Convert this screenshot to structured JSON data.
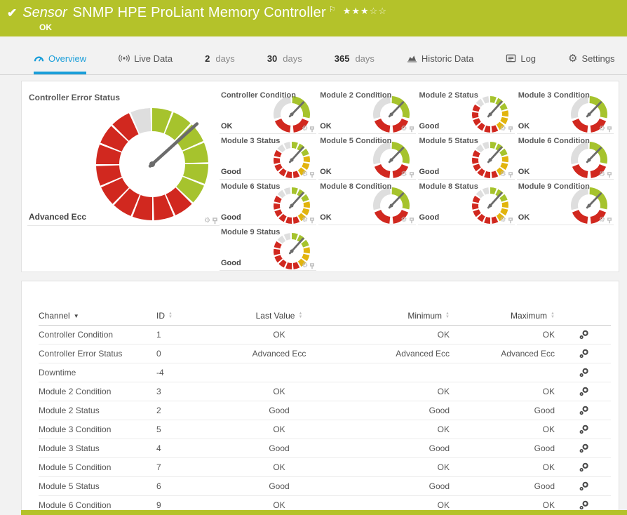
{
  "header": {
    "check_icon": "✔",
    "kind": "Sensor",
    "title": "SNMP HPE ProLiant Memory Controller",
    "priority_stars_filled": "★★★",
    "priority_stars_empty": "☆☆",
    "status": "OK"
  },
  "tabs": {
    "overview": "Overview",
    "live_data": "Live Data",
    "days2_num": "2",
    "days2_unit": "days",
    "days30_num": "30",
    "days30_unit": "days",
    "days365_num": "365",
    "days365_unit": "days",
    "historic": "Historic Data",
    "log": "Log",
    "settings": "Settings",
    "settings_gear": "⚙"
  },
  "gauge_panel": {
    "main": {
      "title": "Controller Error Status",
      "value": "Advanced Ecc",
      "style": "big",
      "needle_deg": 48
    },
    "tiles": [
      {
        "title": "Controller Condition",
        "value": "OK",
        "style": "condition",
        "needle_deg": 44
      },
      {
        "title": "Module 2 Condition",
        "value": "OK",
        "style": "condition",
        "needle_deg": 44
      },
      {
        "title": "Module 2 Status",
        "value": "Good",
        "style": "status",
        "needle_deg": 42
      },
      {
        "title": "Module 3 Condition",
        "value": "OK",
        "style": "condition",
        "needle_deg": 44
      },
      {
        "title": "Module 3 Status",
        "value": "Good",
        "style": "status",
        "needle_deg": 42
      },
      {
        "title": "Module 5 Condition",
        "value": "OK",
        "style": "condition",
        "needle_deg": 44
      },
      {
        "title": "Module 5 Status",
        "value": "Good",
        "style": "status",
        "needle_deg": 42
      },
      {
        "title": "Module 6 Condition",
        "value": "OK",
        "style": "condition",
        "needle_deg": 44
      },
      {
        "title": "Module 6 Status",
        "value": "Good",
        "style": "status",
        "needle_deg": 42
      },
      {
        "title": "Module 8 Condition",
        "value": "OK",
        "style": "condition",
        "needle_deg": 44
      },
      {
        "title": "Module 8 Status",
        "value": "Good",
        "style": "status",
        "needle_deg": 42
      },
      {
        "title": "Module 9 Condition",
        "value": "OK",
        "style": "condition",
        "needle_deg": 44
      },
      {
        "title": "Module 9 Status",
        "value": "Good",
        "style": "status",
        "needle_deg": 42
      }
    ]
  },
  "table": {
    "columns": {
      "channel": "Channel",
      "id": "ID",
      "last": "Last Value",
      "min": "Minimum",
      "max": "Maximum"
    },
    "rows": [
      {
        "channel": "Controller Condition",
        "id": "1",
        "last": "OK",
        "min": "OK",
        "max": "OK"
      },
      {
        "channel": "Controller Error Status",
        "id": "0",
        "last": "Advanced Ecc",
        "min": "Advanced Ecc",
        "max": "Advanced Ecc"
      },
      {
        "channel": "Downtime",
        "id": "-4",
        "last": "",
        "min": "",
        "max": ""
      },
      {
        "channel": "Module 2 Condition",
        "id": "3",
        "last": "OK",
        "min": "OK",
        "max": "OK"
      },
      {
        "channel": "Module 2 Status",
        "id": "2",
        "last": "Good",
        "min": "Good",
        "max": "Good"
      },
      {
        "channel": "Module 3 Condition",
        "id": "5",
        "last": "OK",
        "min": "OK",
        "max": "OK"
      },
      {
        "channel": "Module 3 Status",
        "id": "4",
        "last": "Good",
        "min": "Good",
        "max": "Good"
      },
      {
        "channel": "Module 5 Condition",
        "id": "7",
        "last": "OK",
        "min": "OK",
        "max": "OK"
      },
      {
        "channel": "Module 5 Status",
        "id": "6",
        "last": "Good",
        "min": "Good",
        "max": "Good"
      },
      {
        "channel": "Module 6 Condition",
        "id": "9",
        "last": "OK",
        "min": "OK",
        "max": "OK"
      }
    ]
  },
  "colors": {
    "header_green": "#b4c22a",
    "gauge_green": "#a6c32d",
    "gauge_red": "#d1281f",
    "gauge_yellow": "#e2b40d",
    "gauge_gray": "#dedede",
    "needle_gray": "#6b6b6b",
    "tab_active_blue": "#1a9ed9"
  }
}
